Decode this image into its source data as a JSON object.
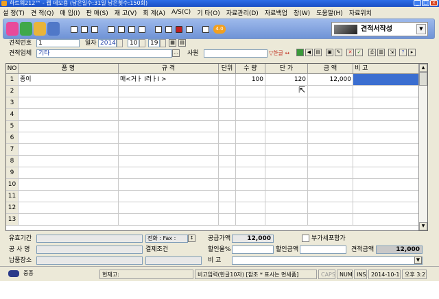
{
  "titlebar": {
    "title": "하트웨212™ - 웹 데모용 (남은일수:31일 남은횟수:150회)"
  },
  "menu": [
    "설 정(T)",
    "견 적(Q)",
    "매 입(I)",
    "판 매(S)",
    "재 고(V)",
    "회 계(A)",
    "A/S(C)",
    "기 타(O)",
    "자료관리(D)",
    "자료백업",
    "창(W)",
    "도움말(H)",
    "자료위치"
  ],
  "toolbar": {
    "form_title": "견적서작성",
    "version_badge": "4.0"
  },
  "form": {
    "quote_no_label": "견적번호",
    "quote_no": "1",
    "date_label": "일자",
    "year": "2014",
    "month": "10",
    "day": "19",
    "client_label": "견적업체",
    "client": "기타",
    "staff_label": "사원",
    "staff": "",
    "lang_toggle": "한글"
  },
  "grid": {
    "headers": [
      "NO",
      "품 명",
      "규 격",
      "단위",
      "수 량",
      "단 가",
      "금 액",
      "비 고"
    ],
    "rows": [
      {
        "no": "1",
        "name": "종이",
        "spec": "매<거ㅏ I러ㅏI >",
        "unit": "",
        "qty": "100",
        "price": "120",
        "amount": "12,000",
        "note": ""
      },
      {
        "no": "2",
        "name": "",
        "spec": "",
        "unit": "",
        "qty": "",
        "price": "",
        "amount": "",
        "note": ""
      },
      {
        "no": "3",
        "name": "",
        "spec": "",
        "unit": "",
        "qty": "",
        "price": "",
        "amount": "",
        "note": ""
      },
      {
        "no": "4",
        "name": "",
        "spec": "",
        "unit": "",
        "qty": "",
        "price": "",
        "amount": "",
        "note": ""
      },
      {
        "no": "5",
        "name": "",
        "spec": "",
        "unit": "",
        "qty": "",
        "price": "",
        "amount": "",
        "note": ""
      },
      {
        "no": "6",
        "name": "",
        "spec": "",
        "unit": "",
        "qty": "",
        "price": "",
        "amount": "",
        "note": ""
      },
      {
        "no": "7",
        "name": "",
        "spec": "",
        "unit": "",
        "qty": "",
        "price": "",
        "amount": "",
        "note": ""
      },
      {
        "no": "8",
        "name": "",
        "spec": "",
        "unit": "",
        "qty": "",
        "price": "",
        "amount": "",
        "note": ""
      },
      {
        "no": "9",
        "name": "",
        "spec": "",
        "unit": "",
        "qty": "",
        "price": "",
        "amount": "",
        "note": ""
      },
      {
        "no": "10",
        "name": "",
        "spec": "",
        "unit": "",
        "qty": "",
        "price": "",
        "amount": "",
        "note": ""
      },
      {
        "no": "11",
        "name": "",
        "spec": "",
        "unit": "",
        "qty": "",
        "price": "",
        "amount": "",
        "note": ""
      },
      {
        "no": "12",
        "name": "",
        "spec": "",
        "unit": "",
        "qty": "",
        "price": "",
        "amount": "",
        "note": ""
      },
      {
        "no": "13",
        "name": "",
        "spec": "",
        "unit": "",
        "qty": "",
        "price": "",
        "amount": "",
        "note": ""
      }
    ]
  },
  "footer": {
    "validity_label": "유효기간",
    "project_label": "공 사 명",
    "delivery_label": "납품장소",
    "phone_label": "전화 :",
    "fax_label": "Fax :",
    "payment_label": "결제조건",
    "supply_label": "공급가액",
    "supply_value": "12,000",
    "vat_label": "부가세포함가",
    "discount_rate_label": "할인율%",
    "discount_amount_label": "할인금액",
    "total_label": "견적금액",
    "total_value": "12,000",
    "note_label": "비 고"
  },
  "statusbar": {
    "user": "중종",
    "stock_label": "현재고:",
    "hint": "비고입력(한글10자) [참조 * 표시는 면세품]",
    "caps": "CAPS",
    "num": "NUM",
    "ins": "INS",
    "date": "2014-10-19",
    "time": "오후 3:27"
  }
}
